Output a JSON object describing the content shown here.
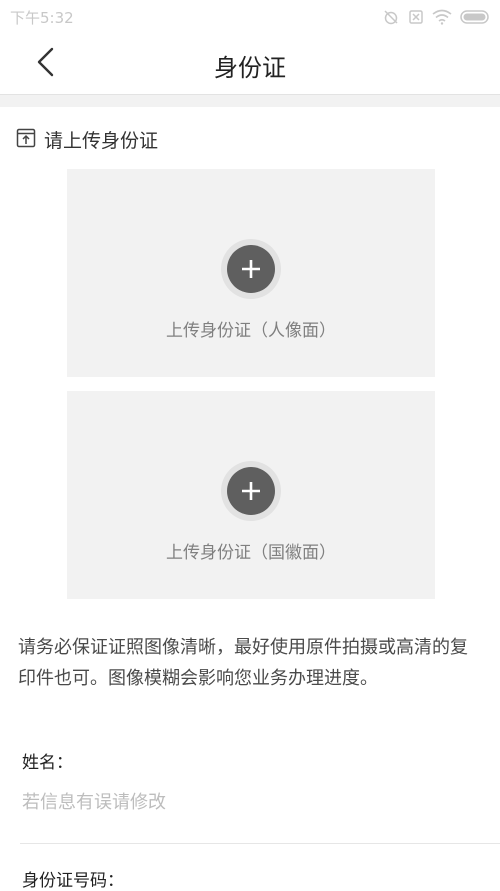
{
  "status_bar": {
    "time": "下午5:32",
    "icons": [
      "alarm-off-icon",
      "sim-icon",
      "wifi-icon",
      "battery-icon"
    ]
  },
  "nav": {
    "title": "身份证",
    "back_icon": "chevron-left-icon"
  },
  "upload_section": {
    "title": "请上传身份证",
    "front_label": "上传身份证（人像面）",
    "back_label": "上传身份证（国徽面）"
  },
  "tip": "请务必保证证照图像清晰，最好使用原件拍摄或高清的复印件也可。图像模糊会影响您业务办理进度。",
  "form": {
    "name_label": "姓名：",
    "name_placeholder": "若信息有误请修改",
    "id_label": "身份证号码："
  },
  "colors": {
    "card_bg": "#f2f2f2",
    "plus_btn": "#5f5f5f",
    "placeholder": "#bdbdbd"
  }
}
